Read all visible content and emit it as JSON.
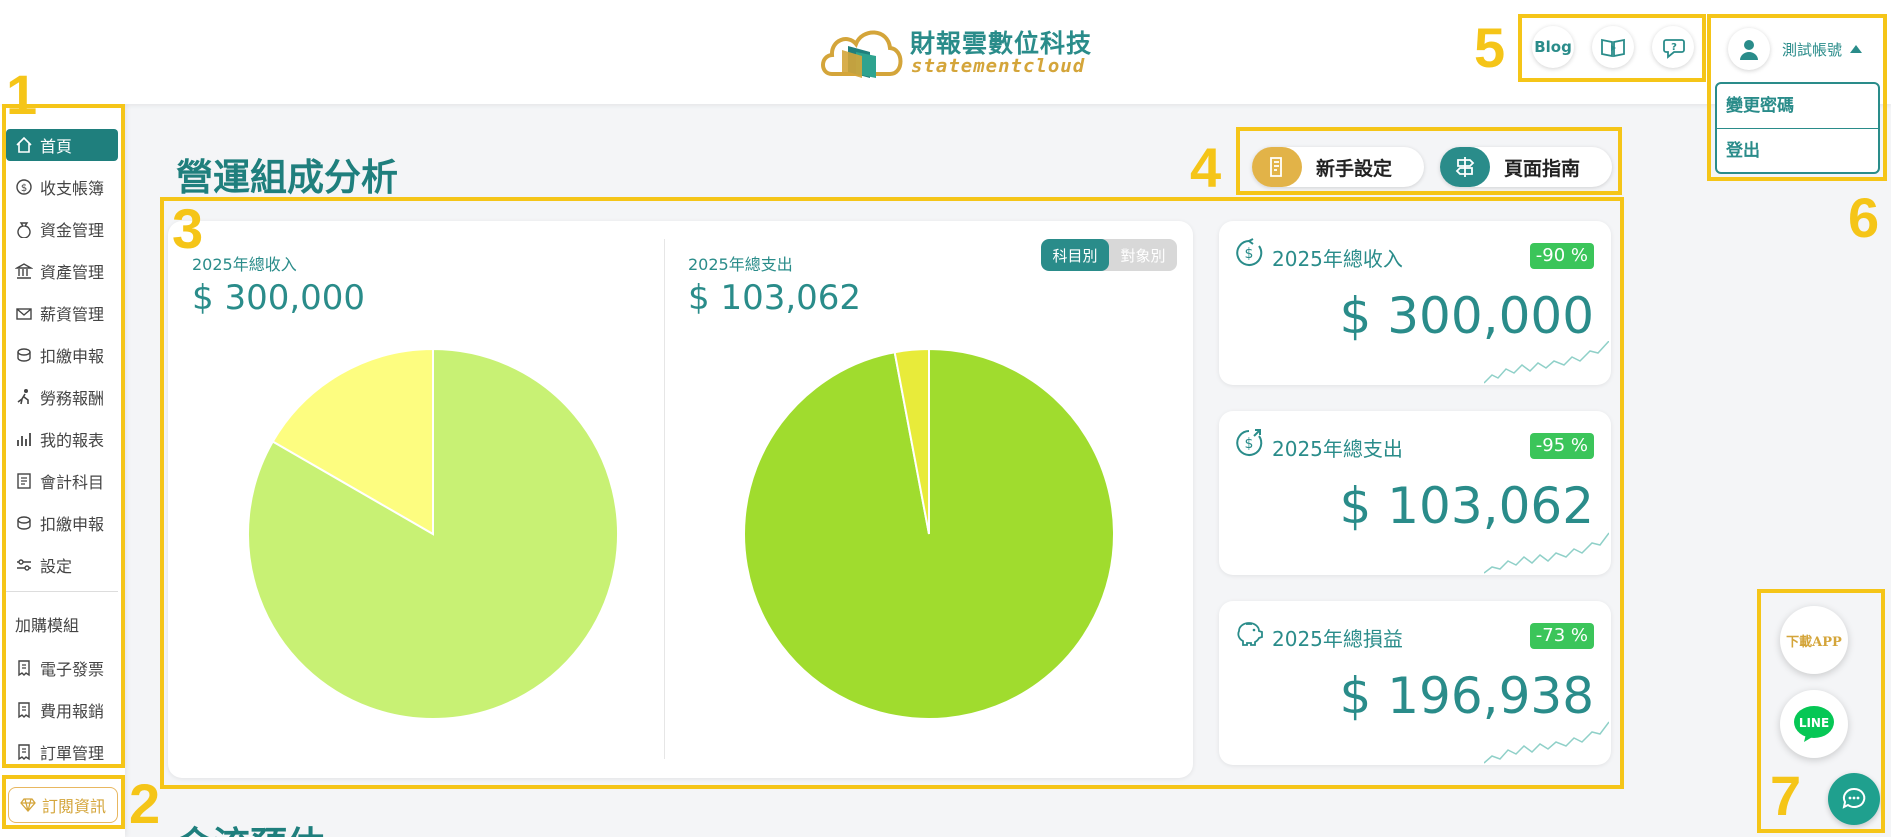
{
  "header": {
    "logo_cn": "財報雲數位科技",
    "logo_en": "statementcloud",
    "blog_label": "Blog",
    "account_name": "測試帳號",
    "dropdown": [
      "變更密碼",
      "登出"
    ]
  },
  "sidebar": {
    "items": [
      {
        "label": "首頁",
        "icon": "home-icon",
        "active": true
      },
      {
        "label": "收支帳簿",
        "icon": "dollar-circle-icon"
      },
      {
        "label": "資金管理",
        "icon": "money-bag-icon"
      },
      {
        "label": "資產管理",
        "icon": "bank-icon"
      },
      {
        "label": "薪資管理",
        "icon": "envelope-icon"
      },
      {
        "label": "扣繳申報",
        "icon": "coins-icon"
      },
      {
        "label": "勞務報酬",
        "icon": "worker-icon"
      },
      {
        "label": "我的報表",
        "icon": "bar-chart-icon"
      },
      {
        "label": "會計科目",
        "icon": "ledger-icon"
      },
      {
        "label": "扣繳申報",
        "icon": "coins-icon"
      },
      {
        "label": "設定",
        "icon": "sliders-icon"
      }
    ],
    "addon_title": "加購模組",
    "addon_items": [
      {
        "label": "電子發票",
        "icon": "receipt-icon"
      },
      {
        "label": "費用報銷",
        "icon": "receipt-icon"
      },
      {
        "label": "訂單管理",
        "icon": "receipt-icon"
      }
    ],
    "subscribe_label": "訂閱資訊"
  },
  "main": {
    "title": "營運組成分析",
    "next_section_title": "金流預估",
    "onboarding_label": "新手設定",
    "guide_label": "頁面指南",
    "toggle": {
      "by_account": "科目別",
      "by_party": "對象別"
    }
  },
  "chart_data": [
    {
      "type": "pie",
      "title": "2025年總收入",
      "total": "$ 300,000",
      "slices": [
        {
          "value": 250000,
          "color": "#c8f174"
        },
        {
          "value": 50000,
          "color": "#fdfd80"
        }
      ]
    },
    {
      "type": "pie",
      "title": "2025年總支出",
      "total": "$ 103,062",
      "slices": [
        {
          "value": 100000,
          "color": "#a0dc2e"
        },
        {
          "value": 3062,
          "color": "#e8eb3a"
        }
      ]
    }
  ],
  "stats": [
    {
      "label": "2025年總收入",
      "value": "$ 300,000",
      "change": "-90 %",
      "icon": "income-dollar-icon"
    },
    {
      "label": "2025年總支出",
      "value": "$ 103,062",
      "change": "-95 %",
      "icon": "expense-dollar-icon"
    },
    {
      "label": "2025年總損益",
      "value": "$ 196,938",
      "change": "-73 %",
      "icon": "piggy-bank-icon"
    }
  ],
  "floating": {
    "download_app": "下載APP",
    "line": "LINE"
  },
  "annotations": [
    "1",
    "2",
    "3",
    "4",
    "5",
    "6",
    "7"
  ],
  "colors": {
    "teal": "#2a8c8a",
    "gold": "#d4a53a",
    "badge_green": "#3bc55a",
    "annotation": "#f5c518"
  }
}
